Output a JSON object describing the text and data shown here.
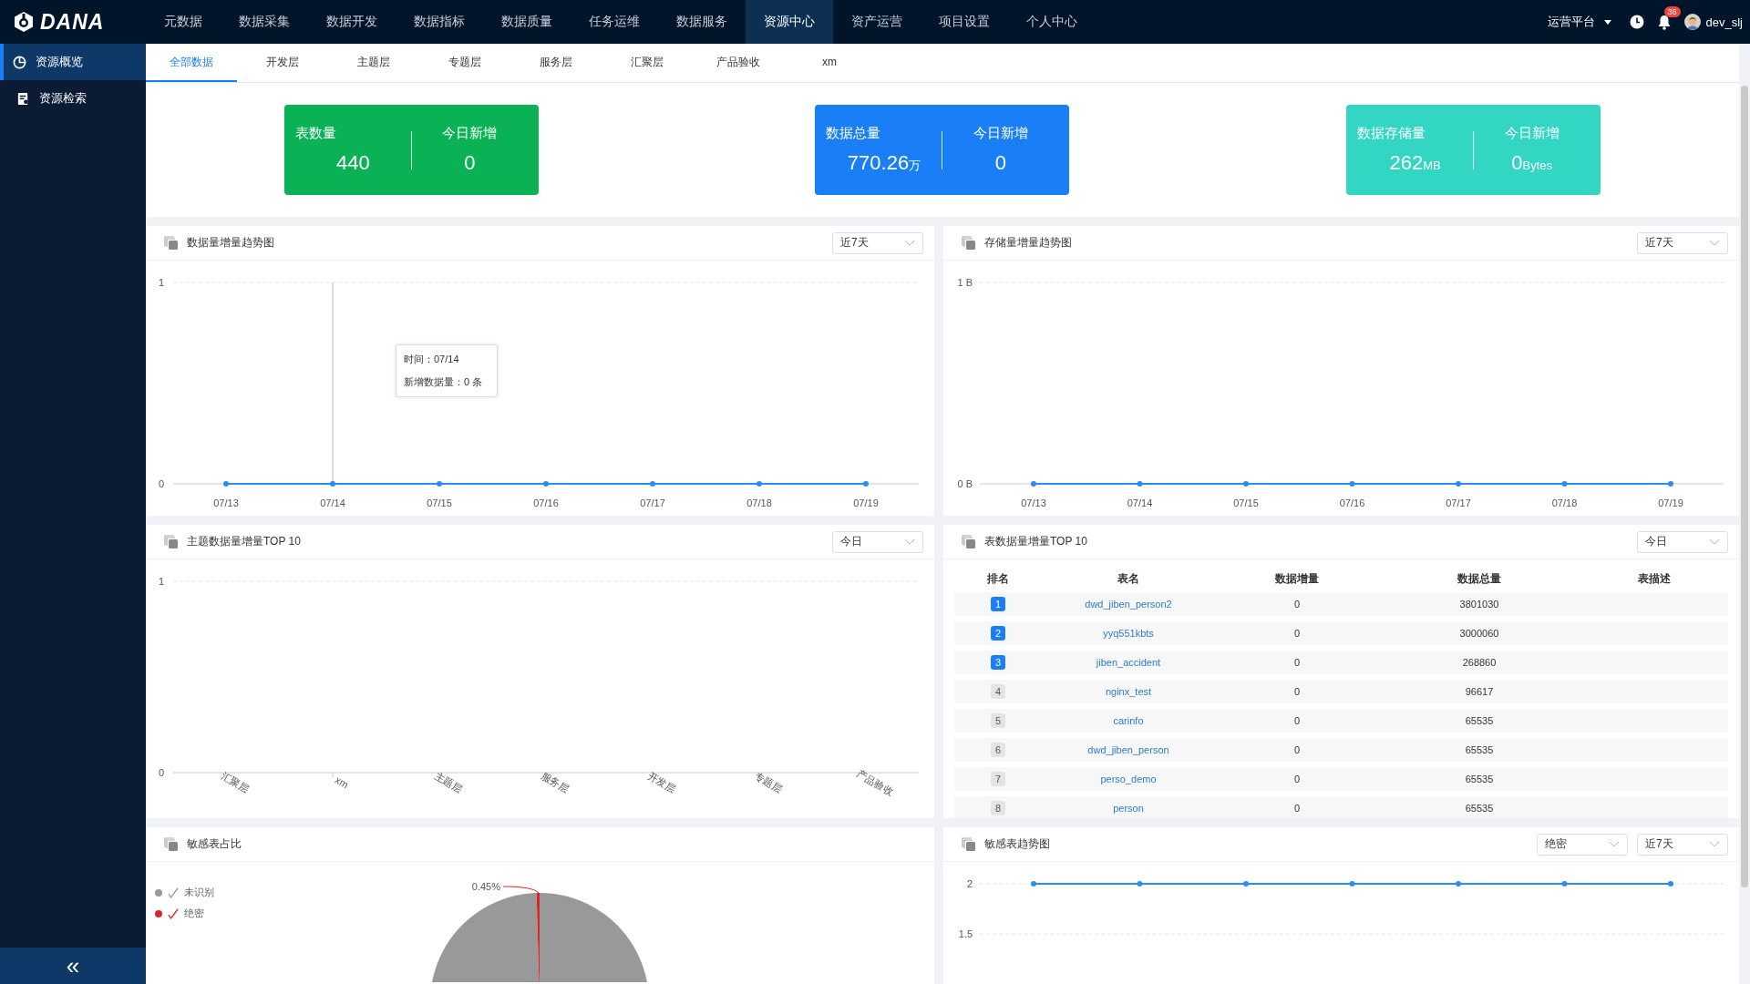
{
  "brand": "DANA",
  "nav": [
    {
      "label": "元数据",
      "selected": false
    },
    {
      "label": "数据采集",
      "selected": false
    },
    {
      "label": "数据开发",
      "selected": false
    },
    {
      "label": "数据指标",
      "selected": false
    },
    {
      "label": "数据质量",
      "selected": false
    },
    {
      "label": "任务运维",
      "selected": false
    },
    {
      "label": "数据服务",
      "selected": false
    },
    {
      "label": "资源中心",
      "selected": true
    },
    {
      "label": "资产运营",
      "selected": false
    },
    {
      "label": "项目设置",
      "selected": false
    },
    {
      "label": "个人中心",
      "selected": false
    }
  ],
  "user_bar": {
    "platform": "运营平台",
    "notifications": "36",
    "username": "dev_slj"
  },
  "sidebar": {
    "items": [
      {
        "label": "资源概览",
        "kind": "overview",
        "selected": true
      },
      {
        "label": "资源检索",
        "kind": "search",
        "selected": false
      }
    ],
    "collapse": "«"
  },
  "tabs": [
    {
      "label": "全部数据",
      "selected": true
    },
    {
      "label": "开发层",
      "selected": false
    },
    {
      "label": "主题层",
      "selected": false
    },
    {
      "label": "专题层",
      "selected": false
    },
    {
      "label": "服务层",
      "selected": false
    },
    {
      "label": "汇聚层",
      "selected": false
    },
    {
      "label": "产品验收",
      "selected": false
    },
    {
      "label": "xm",
      "selected": false
    }
  ],
  "stats": [
    {
      "title": "表数量",
      "value": "440",
      "today_title": "今日新增",
      "today": "0",
      "color": "#0ab155"
    },
    {
      "title": "数据总量",
      "value": "770.26",
      "unit": "万",
      "today_title": "今日新增",
      "today": "0",
      "color": "#1a7ff6"
    },
    {
      "title": "数据存储量",
      "value": "262",
      "unit": "MB",
      "today_title": "今日新增",
      "today": "0",
      "today_unit": "Bytes",
      "color": "#33d5c3"
    }
  ],
  "data_trend": {
    "title": "数据量增量趋势图",
    "range": "近7天",
    "tooltip": {
      "time": "时间：07/14",
      "value": "新增数据量：0 条"
    },
    "chart_data": {
      "type": "line",
      "categories": [
        "07/13",
        "07/14",
        "07/15",
        "07/16",
        "07/17",
        "07/18",
        "07/19"
      ],
      "series": [
        {
          "color": "#2d8cf0",
          "marker": true,
          "values": [
            0,
            0,
            0,
            0,
            0,
            0,
            0
          ]
        }
      ],
      "ylim": [
        0,
        1
      ],
      "yticks": [
        0,
        1
      ]
    }
  },
  "storage_trend": {
    "title": "存储量增量趋势图",
    "range": "近7天",
    "chart_data": {
      "type": "line",
      "categories": [
        "07/13",
        "07/14",
        "07/15",
        "07/16",
        "07/17",
        "07/18",
        "07/19"
      ],
      "series": [
        {
          "color": "#2d8cf0",
          "marker": true,
          "values": [
            0,
            0,
            0,
            0,
            0,
            0,
            0
          ]
        }
      ],
      "ylim": [
        0,
        1
      ],
      "yticks": [
        {
          "value": 0,
          "label": "0 B"
        },
        {
          "value": 1,
          "label": "1 B"
        }
      ]
    }
  },
  "topic_top10": {
    "title": "主题数据量增量TOP 10",
    "range": "今日",
    "chart_data": {
      "type": "bar",
      "categories": [
        "汇聚层",
        "xm",
        "主题层",
        "服务层",
        "开发层",
        "专题层",
        "产品验收"
      ],
      "series": [
        {
          "values": [
            0,
            0,
            0,
            0,
            0,
            0,
            0
          ]
        }
      ],
      "ylim": [
        0,
        1
      ],
      "yticks": [
        0,
        1
      ]
    }
  },
  "table_top10": {
    "title": "表数据量增量TOP 10",
    "range": "今日",
    "columns": [
      "排名",
      "表名",
      "数据增量",
      "数据总量",
      "表描述"
    ],
    "rows": [
      {
        "rank": "1",
        "highlight": true,
        "name": "dwd_jiben_person2",
        "increment": "0",
        "total": "3801030"
      },
      {
        "rank": "2",
        "highlight": true,
        "name": "yyq551kbts",
        "increment": "0",
        "total": "3000060"
      },
      {
        "rank": "3",
        "highlight": true,
        "name": "jiben_accident",
        "increment": "0",
        "total": "268860"
      },
      {
        "rank": "4",
        "highlight": false,
        "name": "nginx_test",
        "increment": "0",
        "total": "96617"
      },
      {
        "rank": "5",
        "highlight": false,
        "name": "carinfo",
        "increment": "0",
        "total": "65535"
      },
      {
        "rank": "6",
        "highlight": false,
        "name": "dwd_jiben_person",
        "increment": "0",
        "total": "65535"
      },
      {
        "rank": "7",
        "highlight": false,
        "name": "perso_demo",
        "increment": "0",
        "total": "65535"
      },
      {
        "rank": "8",
        "highlight": false,
        "name": "person",
        "increment": "0",
        "total": "65535"
      }
    ]
  },
  "sensitive_ratio": {
    "title": "敏感表占比",
    "chart_data": {
      "type": "pie",
      "categories": [
        "未识别",
        "绝密"
      ],
      "series": [
        {
          "values": [
            99.55,
            0.45
          ]
        }
      ],
      "colors": [
        "#999999",
        "#d9262a"
      ],
      "value_labels": [
        null,
        "0.45%"
      ]
    }
  },
  "sensitive_trend": {
    "title": "敏感表趋势图",
    "level_filter": "绝密",
    "range": "近7天",
    "chart_data": {
      "type": "line",
      "series": [
        {
          "color": "#2d8cf0",
          "marker": true,
          "values": [
            2,
            2,
            2,
            2,
            2,
            2,
            2
          ]
        }
      ],
      "ylim": [
        1.5,
        2
      ],
      "yticks": [
        1.5,
        2
      ]
    }
  }
}
